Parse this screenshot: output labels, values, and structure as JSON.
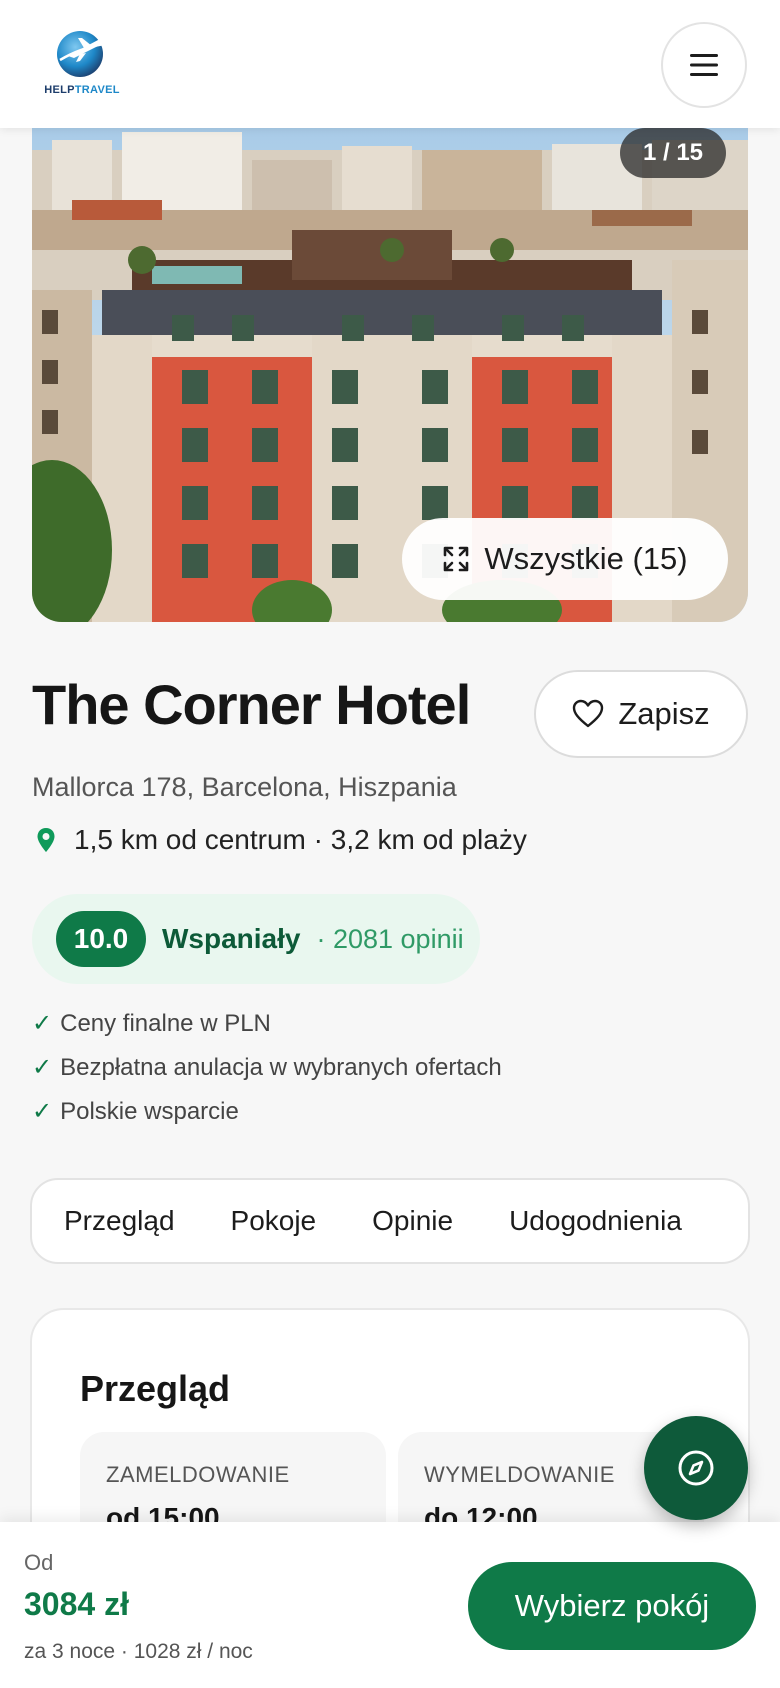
{
  "header": {
    "logo_help": "HELP",
    "logo_travel": "TRAVEL"
  },
  "gallery": {
    "counter": "1 / 15",
    "all_photos_label": "Wszystkie (15)"
  },
  "hotel": {
    "name": "The Corner Hotel",
    "save_label": "Zapisz",
    "address": "Mallorca 178, Barcelona, Hiszpania",
    "distance": "1,5 km od centrum · 3,2 km od plaży",
    "rating": {
      "score": "10.0",
      "label": "Wspaniały",
      "count": "· 2081 opinii"
    },
    "perks": [
      "Ceny finalne w PLN",
      "Bezpłatna anulacja w wybranych ofertach",
      "Polskie wsparcie"
    ]
  },
  "tabs": [
    "Przegląd",
    "Pokoje",
    "Opinie",
    "Udogodnienia"
  ],
  "overview": {
    "title": "Przegląd",
    "checkin_label": "ZAMELDOWANIE",
    "checkin_value": "od 15:00",
    "checkout_label": "WYMELDOWANIE",
    "checkout_value": "do 12:00"
  },
  "booking_bar": {
    "from_label": "Od",
    "price": "3084 zł",
    "price_detail": "za 3 noce · 1028 zł / noc",
    "cta": "Wybierz pokój"
  },
  "colors": {
    "brand_green": "#0f7a48",
    "dark_green": "#0e5a3a",
    "rating_bg": "#e9f7ef",
    "logo_navy": "#1d3d6b",
    "logo_blue": "#1e88c8"
  },
  "icons": {
    "menu": "hamburger-icon",
    "expand": "expand-icon",
    "heart": "heart-icon",
    "location": "map-pin-icon",
    "compass": "compass-icon",
    "logo": "airplane-globe-logo"
  }
}
